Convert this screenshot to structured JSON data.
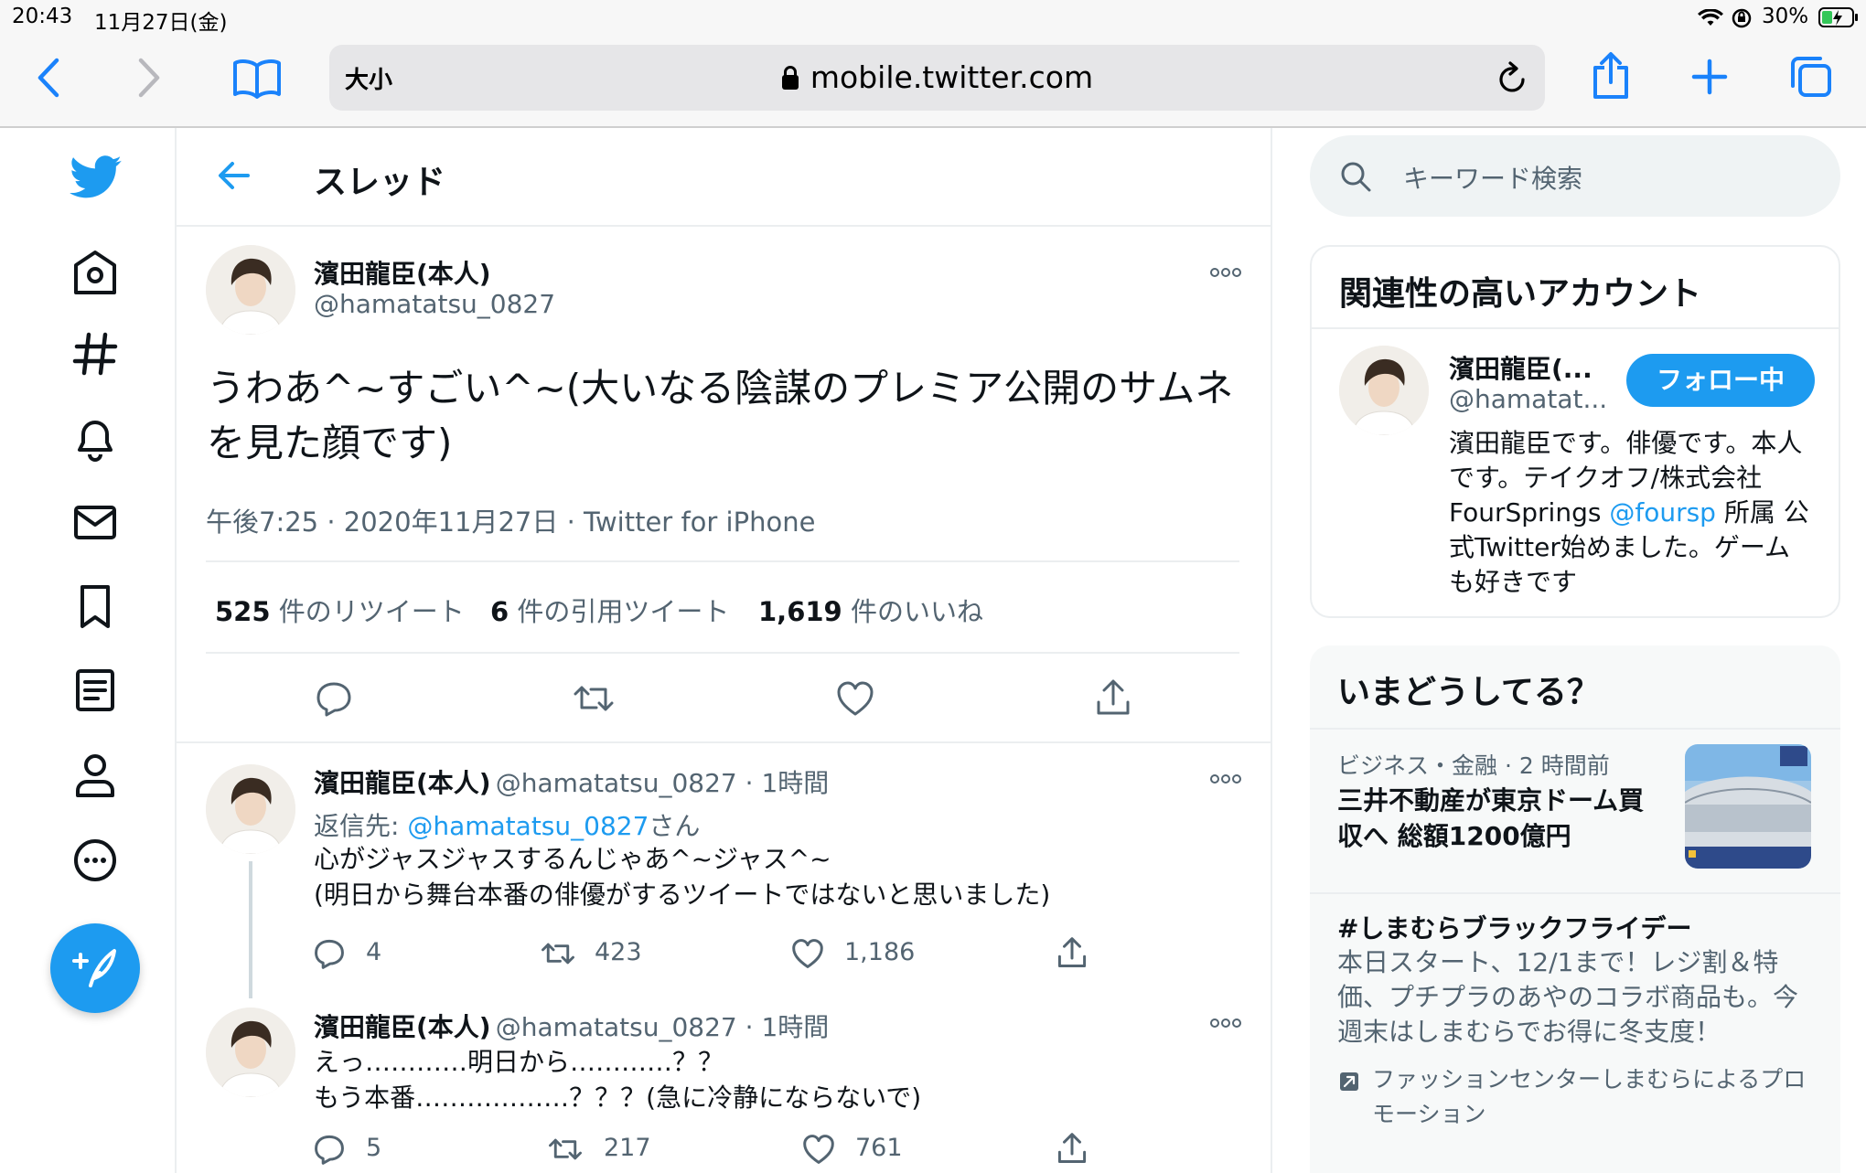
{
  "status": {
    "time": "20:43",
    "date": "11月27日(金)",
    "battery": "30%"
  },
  "browser": {
    "text_size_label": "大小",
    "url": "mobile.twitter.com"
  },
  "thread": {
    "title": "スレッド",
    "main_tweet": {
      "name": "濱田龍臣(本人)",
      "handle": "@hamatatsu_0827",
      "text_line1": "うわあ^~すごい^~(大いなる陰謀のプレミア公開のサムネ",
      "text_line2": "を見た顔です)",
      "meta": "午後7:25 · 2020年11月27日 · Twitter for iPhone",
      "retweets_count": "525",
      "retweets_label": "件のリツイート",
      "quotes_count": "6",
      "quotes_label": "件の引用ツイート",
      "likes_count": "1,619",
      "likes_label": "件のいいね"
    },
    "replies": [
      {
        "name": "濱田龍臣(本人)",
        "handle_time": "@hamatatsu_0827 · 1時間",
        "reply_to_prefix": "返信先: ",
        "reply_to_handle": "@hamatatsu_0827",
        "reply_to_suffix": "さん",
        "line1": "心がジャスジャスするんじゃあ^~ジャス^~",
        "line2": "(明日から舞台本番の俳優がするツイートではないと思いました)",
        "replies": "4",
        "retweets": "423",
        "likes": "1,186"
      },
      {
        "name": "濱田龍臣(本人)",
        "handle_time": "@hamatatsu_0827 · 1時間",
        "line1": "えっ…………明日から…………？？",
        "line2": "もう本番………………？？？(急に冷静にならないで)",
        "replies": "5",
        "retweets": "217",
        "likes": "761"
      }
    ]
  },
  "sidebar": {
    "search_placeholder": "キーワード検索",
    "who_to_follow": {
      "title": "関連性の高いアカウント",
      "name": "濱田龍臣(...",
      "handle": "@hamatat...",
      "button": "フォロー中",
      "bio_line1": "濱田龍臣です。俳優です。本人",
      "bio_line2": "です。テイクオフ/株式会社",
      "bio_line3_a": "FourSprings ",
      "bio_line3_link": "@foursp",
      "bio_line3_b": " 所属 公",
      "bio_line4": "式Twitter始めました。ゲーム",
      "bio_line5": "も好きです"
    },
    "trends": {
      "title": "いまどうしてる？",
      "items": [
        {
          "meta": "ビジネス・金融 · 2 時間前",
          "title_line1": "三井不動産が東京ドーム買",
          "title_line2": "収へ 総額1200億円"
        },
        {
          "title": "#しまむらブラックフライデー",
          "desc_line1": "本日スタート、12/1まで！レジ割＆特",
          "desc_line2": "価、プチプラのあやのコラボ商品も。今",
          "desc_line3": "週末はしまむらでお得に冬支度！",
          "promo_line1": "ファッションセンターしまむらによるプロ",
          "promo_line2": "モーション"
        }
      ]
    }
  },
  "colors": {
    "accent": "#1d9bf0",
    "text": "#0f1419",
    "muted": "#536471",
    "safari_blue": "#1a82fb"
  }
}
